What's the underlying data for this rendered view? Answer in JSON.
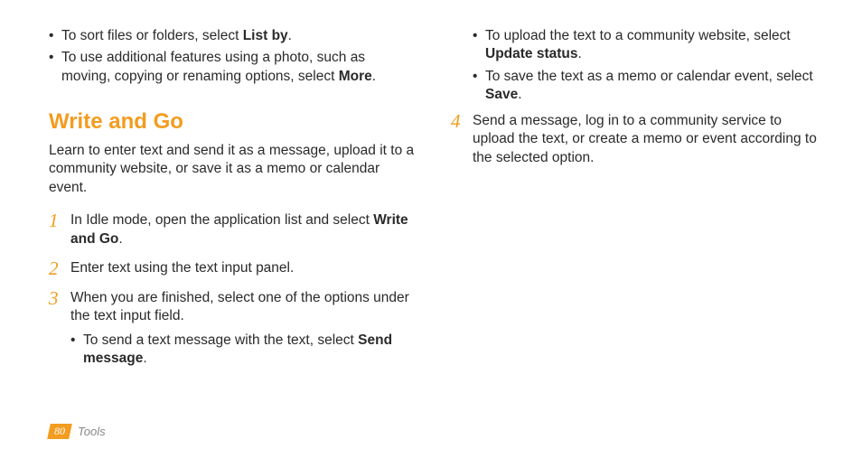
{
  "left": {
    "bullets": [
      {
        "pre": "To sort files or folders, select ",
        "bold": "List by",
        "post": "."
      },
      {
        "pre": "To use additional features using a photo, such as moving, copying or renaming options, select ",
        "bold": "More",
        "post": "."
      }
    ],
    "heading": "Write and Go",
    "intro": "Learn to enter text and send it as a message, upload it to a community website, or save it as a memo or calendar event.",
    "steps": [
      {
        "num": "1",
        "pre": "In Idle mode, open the application list and select ",
        "bold": "Write and Go",
        "post": "."
      },
      {
        "num": "2",
        "pre": "Enter text using the text input panel.",
        "bold": "",
        "post": ""
      },
      {
        "num": "3",
        "pre": "When you are finished, select one of the options under the text input field.",
        "bold": "",
        "post": "",
        "sub": [
          {
            "pre": "To send a text message with the text, select ",
            "bold": "Send message",
            "post": "."
          }
        ]
      }
    ]
  },
  "right": {
    "subcont": [
      {
        "pre": "To upload the text to a community website, select ",
        "bold": "Update status",
        "post": "."
      },
      {
        "pre": "To save the text as a memo or calendar event, select ",
        "bold": "Save",
        "post": "."
      }
    ],
    "step4": {
      "num": "4",
      "text": "Send a message, log in to a community service to upload the text, or create a memo or event according to the selected option."
    }
  },
  "footer": {
    "page": "80",
    "section": "Tools"
  }
}
